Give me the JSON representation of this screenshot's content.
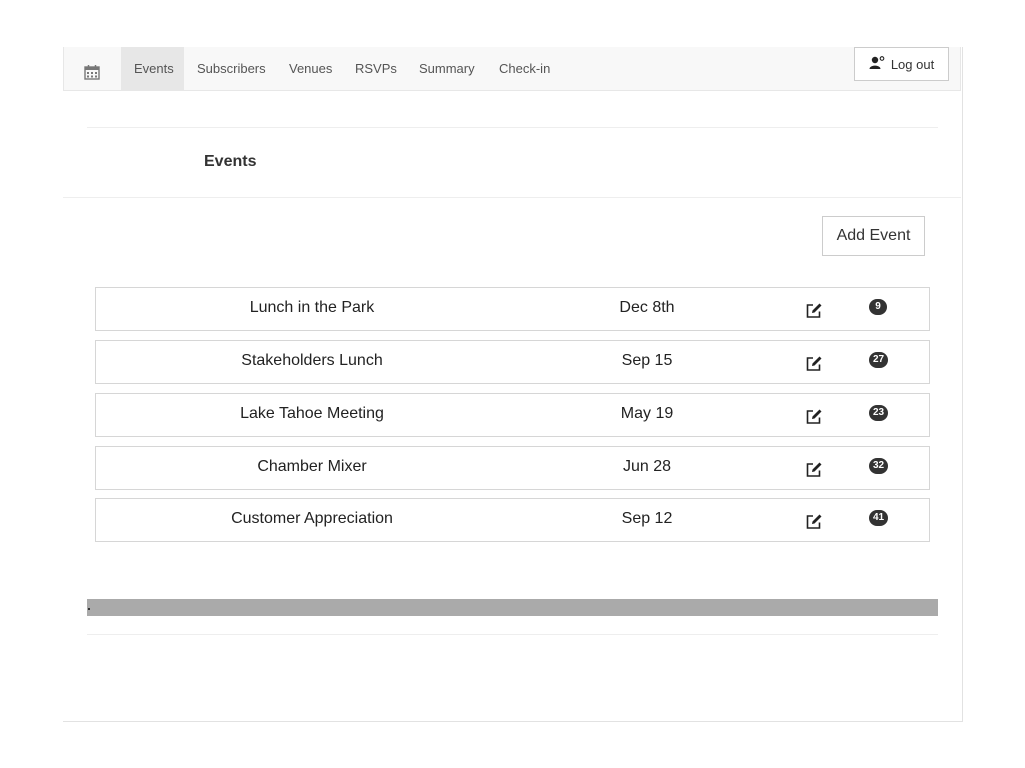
{
  "nav": {
    "brand_icon": "calendar-icon",
    "items": [
      {
        "label": "Events",
        "active": true
      },
      {
        "label": "Subscribers",
        "active": false
      },
      {
        "label": "Venues",
        "active": false
      },
      {
        "label": "RSVPs",
        "active": false
      },
      {
        "label": "Summary",
        "active": false
      },
      {
        "label": "Check-in",
        "active": false
      }
    ],
    "logout": {
      "label": "Log out",
      "icon": "user-icon"
    }
  },
  "page": {
    "title": "Events",
    "add_button": "Add Event"
  },
  "events": [
    {
      "name": "Lunch in the Park",
      "date": "Dec 8th",
      "count": "9"
    },
    {
      "name": "Stakeholders Lunch",
      "date": "Sep 15",
      "count": "27"
    },
    {
      "name": "Lake Tahoe Meeting",
      "date": "May 19",
      "count": "23"
    },
    {
      "name": "Chamber Mixer",
      "date": "Jun 28",
      "count": "32"
    },
    {
      "name": "Customer Appreciation",
      "date": "Sep 12",
      "count": "41"
    }
  ],
  "colors": {
    "navbar_bg": "#f8f8f8",
    "nav_active_bg": "#e7e7e7",
    "badge_bg": "#333333",
    "progress_bar": "#aaaaaa"
  }
}
